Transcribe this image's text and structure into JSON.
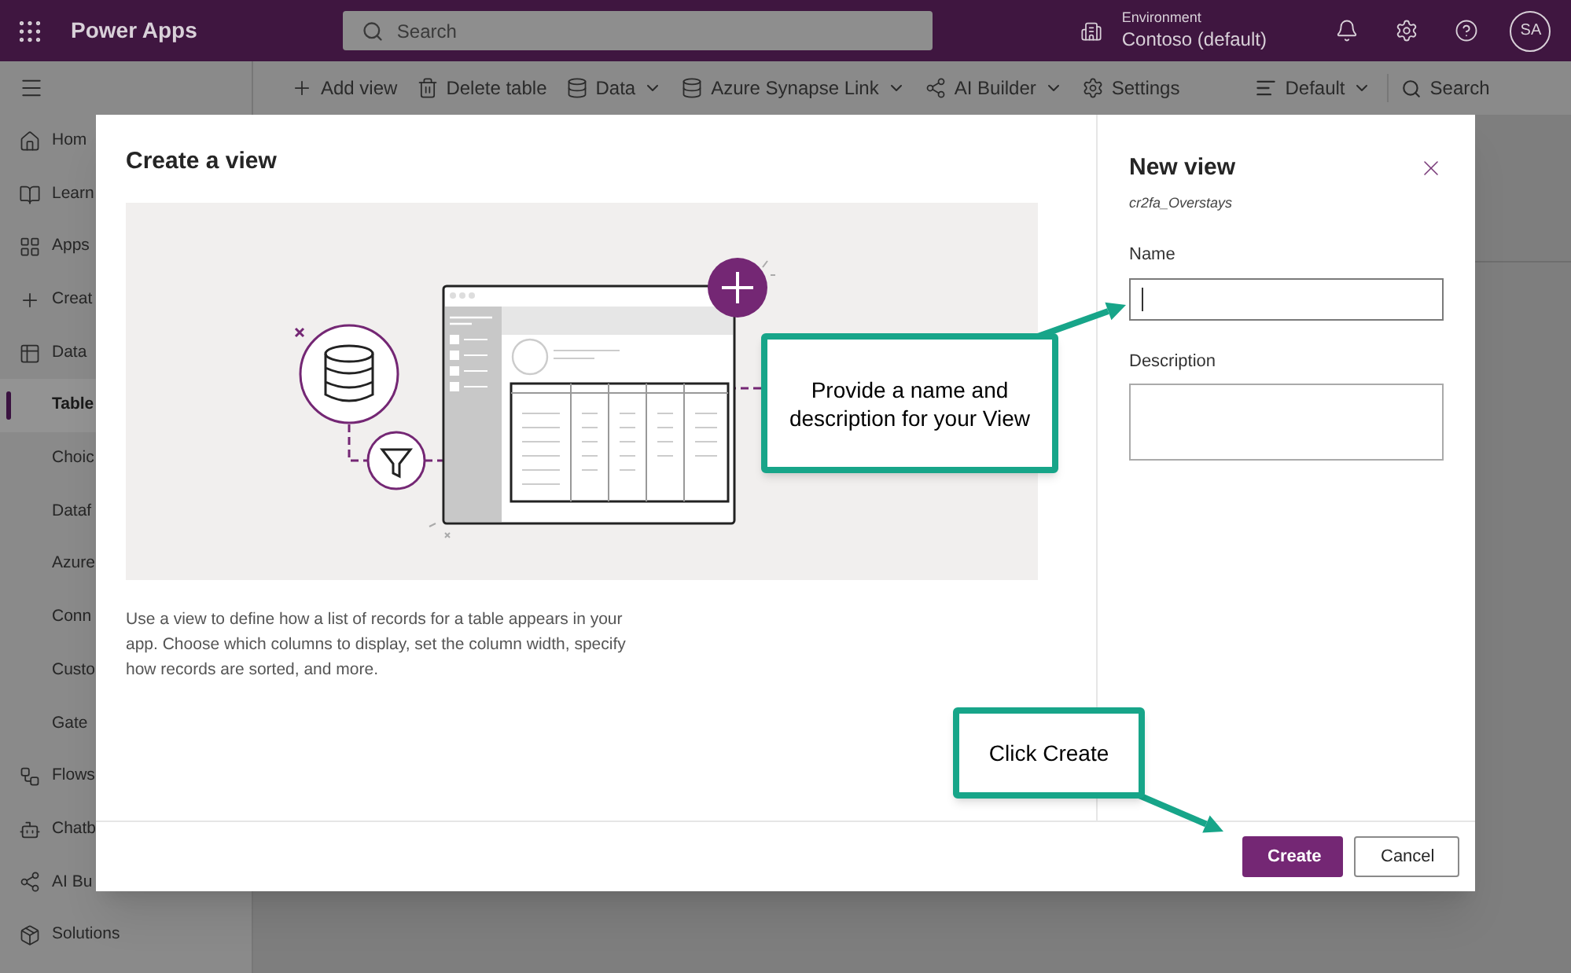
{
  "top_bar": {
    "app_name": "Power Apps",
    "search": {
      "placeholder": "Search"
    },
    "environment": {
      "label": "Environment",
      "value": "Contoso (default)"
    },
    "avatar": "SA"
  },
  "command_bar": {
    "items": [
      {
        "label": "Add view",
        "dropdown": false
      },
      {
        "label": "Delete table",
        "dropdown": false
      },
      {
        "label": "Data",
        "dropdown": true
      },
      {
        "label": "Azure Synapse Link",
        "dropdown": true
      },
      {
        "label": "AI Builder",
        "dropdown": true
      },
      {
        "label": "Settings",
        "dropdown": false
      }
    ],
    "view_selector": "Default",
    "search": "Search"
  },
  "sidebar": {
    "items": [
      {
        "label": "Hom",
        "selected": false
      },
      {
        "label": "Learn",
        "selected": false
      },
      {
        "label": "Apps",
        "selected": false
      },
      {
        "label": "Creat",
        "selected": false
      },
      {
        "label": "Data",
        "selected": false,
        "children": [
          {
            "label": "Table",
            "selected": true
          },
          {
            "label": "Choic",
            "selected": false
          },
          {
            "label": "Dataf",
            "selected": false
          },
          {
            "label": "Azure",
            "selected": false
          },
          {
            "label": "Conn",
            "selected": false
          },
          {
            "label": "Custo",
            "selected": false
          },
          {
            "label": "Gate",
            "selected": false
          }
        ]
      },
      {
        "label": "Flows",
        "selected": false
      },
      {
        "label": "Chatb",
        "selected": false
      },
      {
        "label": "AI Bu",
        "selected": false
      },
      {
        "label": "Solutions",
        "selected": false
      }
    ]
  },
  "dialog": {
    "title": "Create a view",
    "description": "Use a view to define how a list of records for a table appears in your app. Choose which columns to display, set the column width, specify how records are sorted, and more.",
    "panel": {
      "title": "New view",
      "subtitle": "cr2fa_Overstays",
      "fields": [
        {
          "label": "Name",
          "kind": "input",
          "focused": true
        },
        {
          "label": "Description",
          "kind": "textarea",
          "focused": false
        }
      ]
    },
    "buttons": [
      {
        "label": "Create",
        "primary": true
      },
      {
        "label": "Cancel",
        "primary": false
      }
    ]
  },
  "callouts": [
    {
      "text": "Provide a name and description for your View"
    },
    {
      "text": "Click Create"
    }
  ]
}
